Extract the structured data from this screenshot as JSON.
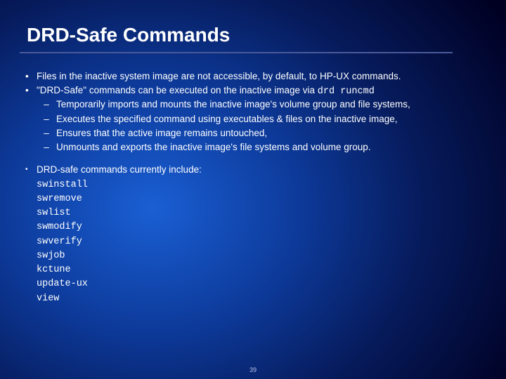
{
  "title": "DRD-Safe Commands",
  "bullets": {
    "b1": "Files in the inactive system image are not accessible, by default, to HP-UX commands.",
    "b2_pre": "\"DRD-Safe\" commands can be executed on the inactive image via ",
    "b2_code": "drd runcmd",
    "subs": {
      "s1": "Temporarily imports and mounts the inactive image's volume group and file systems,",
      "s2": "Executes the specified command using executables & files on the inactive image,",
      "s3": "Ensures that the active image remains untouched,",
      "s4": "Unmounts and exports the inactive image's file systems and volume group."
    },
    "b3": "DRD-safe commands currently include:"
  },
  "commands": {
    "c1": "swinstall",
    "c2": "swremove",
    "c3": "swlist",
    "c4": "swmodify",
    "c5": "swverify",
    "c6": "swjob",
    "c7": "kctune",
    "c8": "update-ux",
    "c9": "view"
  },
  "page_number": "39",
  "marks": {
    "dot": "•",
    "dash": "–"
  }
}
